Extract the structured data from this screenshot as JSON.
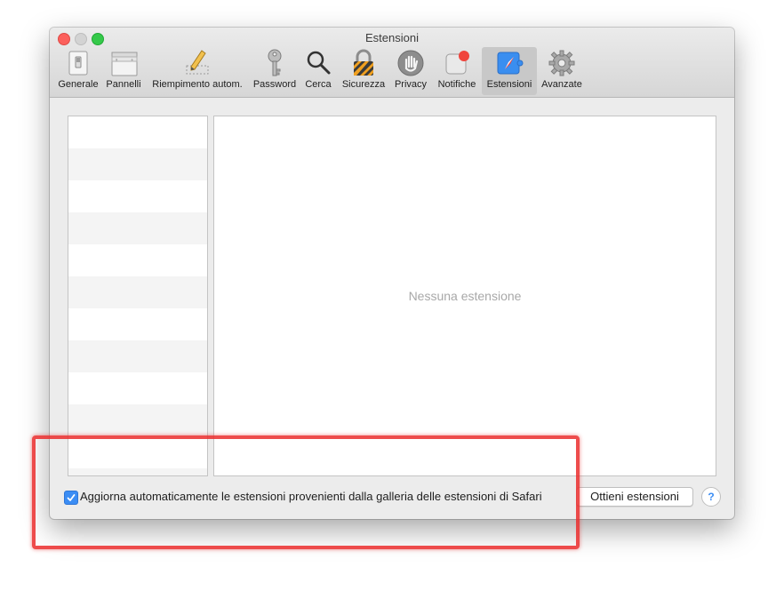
{
  "window": {
    "title": "Estensioni"
  },
  "toolbar": {
    "items": [
      {
        "label": "Generale",
        "icon": "general-switch-icon"
      },
      {
        "label": "Pannelli",
        "icon": "tabs-window-icon"
      },
      {
        "label": "Riempimento autom.",
        "icon": "pencil-form-icon"
      },
      {
        "label": "Password",
        "icon": "key-icon"
      },
      {
        "label": "Cerca",
        "icon": "magnifier-icon"
      },
      {
        "label": "Sicurezza",
        "icon": "padlock-icon"
      },
      {
        "label": "Privacy",
        "icon": "hand-icon"
      },
      {
        "label": "Notifiche",
        "icon": "notification-badge-icon"
      },
      {
        "label": "Estensioni",
        "icon": "puzzle-compass-icon",
        "active": true
      },
      {
        "label": "Avanzate",
        "icon": "gear-icon"
      }
    ]
  },
  "content": {
    "empty_message": "Nessuna estensione"
  },
  "footer": {
    "auto_update_label": "Aggiorna automaticamente le estensioni provenienti dalla galleria delle estensioni di Safari",
    "auto_update_checked": true,
    "get_extensions_button": "Ottieni estensioni",
    "help_label": "?"
  },
  "colors": {
    "accent": "#3b8df4",
    "highlight": "#eb2d2d",
    "close": "#fc605c",
    "maximize": "#35c94a"
  }
}
